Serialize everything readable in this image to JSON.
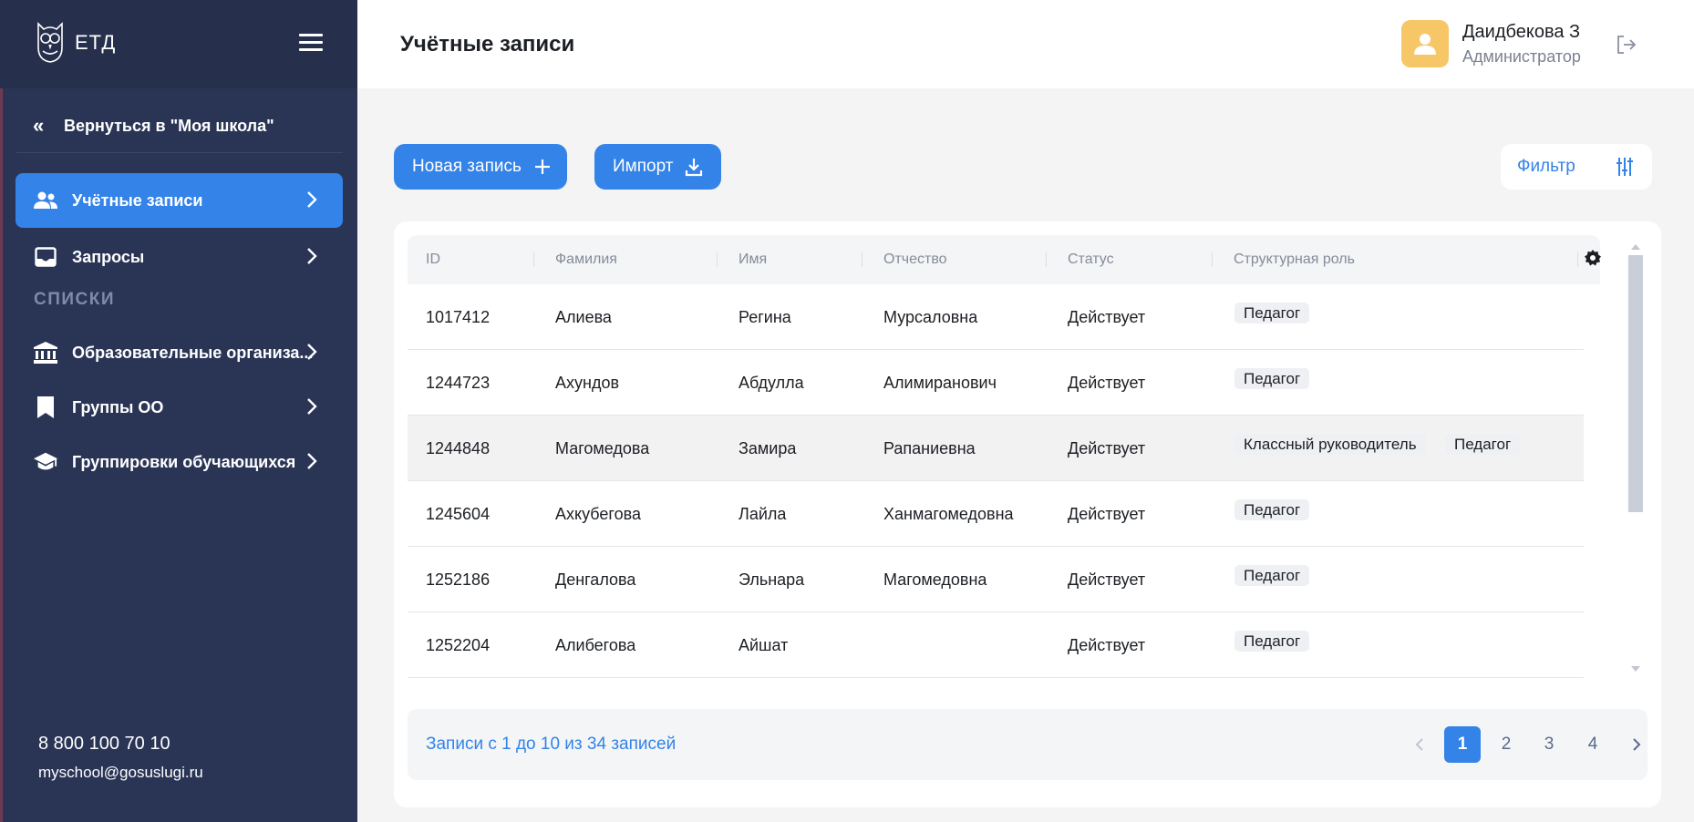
{
  "app": {
    "logo_text": "ЕТД"
  },
  "sidebar": {
    "back_label": "Вернуться в \"Моя школа\"",
    "items": [
      {
        "label": "Учётные записи"
      },
      {
        "label": "Запросы"
      }
    ],
    "section_title": "СПИСКИ",
    "list_items": [
      {
        "label": "Образовательные организа..."
      },
      {
        "label": "Группы ОО"
      },
      {
        "label": "Группировки обучающихся"
      }
    ],
    "phone": "8 800 100 70 10",
    "email": "myschool@gosuslugi.ru"
  },
  "header": {
    "title": "Учётные записи",
    "user_name": "Даидбекова З",
    "user_role": "Администратор"
  },
  "toolbar": {
    "new_record_label": "Новая запись",
    "import_label": "Импорт",
    "filter_label": "Фильтр"
  },
  "table": {
    "columns": [
      "ID",
      "Фамилия",
      "Имя",
      "Отчество",
      "Статус",
      "Структурная роль"
    ],
    "rows": [
      {
        "id": "1017412",
        "last": "Алиева",
        "first": "Регина",
        "middle": "Мурсаловна",
        "status": "Действует",
        "roles": [
          "Педагог"
        ]
      },
      {
        "id": "1244723",
        "last": "Ахундов",
        "first": "Абдулла",
        "middle": "Алимиранович",
        "status": "Действует",
        "roles": [
          "Педагог"
        ]
      },
      {
        "id": "1244848",
        "last": "Магомедова",
        "first": "Замира",
        "middle": "Рапаниевна",
        "status": "Действует",
        "roles": [
          "Классный руководитель",
          "Педагог"
        ]
      },
      {
        "id": "1245604",
        "last": "Ахкубегова",
        "first": "Лайла",
        "middle": "Ханмагомедовна",
        "status": "Действует",
        "roles": [
          "Педагог"
        ]
      },
      {
        "id": "1252186",
        "last": "Денгалова",
        "first": "Эльнара",
        "middle": "Магомедовна",
        "status": "Действует",
        "roles": [
          "Педагог"
        ]
      },
      {
        "id": "1252204",
        "last": "Алибегова",
        "first": "Айшат",
        "middle": "",
        "status": "Действует",
        "roles": [
          "Педагог"
        ]
      }
    ]
  },
  "pagination": {
    "summary": "Записи с 1 до 10 из 34 записей",
    "pages": [
      "1",
      "2",
      "3",
      "4"
    ],
    "current": "1"
  },
  "colors": {
    "accent": "#3383e8",
    "sidebar": "#2a3556",
    "avatar": "#f7c667"
  }
}
